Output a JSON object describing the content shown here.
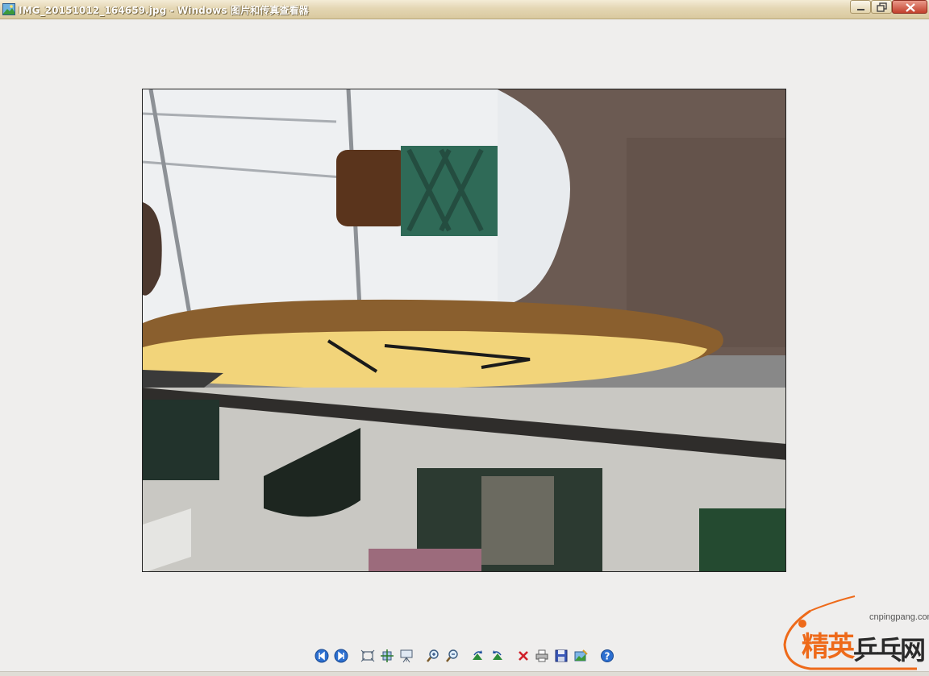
{
  "window": {
    "title": "IMG_20151012_164659.jpg - Windows 图片和传真查看器"
  },
  "toolbar": {
    "buttons": [
      {
        "name": "previous-image-button",
        "icon": "prev-circle-icon"
      },
      {
        "name": "next-image-button",
        "icon": "next-circle-icon"
      },
      {
        "name": "best-fit-button",
        "icon": "best-fit-icon"
      },
      {
        "name": "actual-size-button",
        "icon": "actual-size-icon"
      },
      {
        "name": "slideshow-button",
        "icon": "slideshow-icon"
      },
      {
        "name": "zoom-in-button",
        "icon": "zoom-in-icon"
      },
      {
        "name": "zoom-out-button",
        "icon": "zoom-out-icon"
      },
      {
        "name": "rotate-clockwise-button",
        "icon": "rotate-cw-icon"
      },
      {
        "name": "rotate-counterclockwise-button",
        "icon": "rotate-ccw-icon"
      },
      {
        "name": "delete-button",
        "icon": "delete-x-icon"
      },
      {
        "name": "print-button",
        "icon": "printer-icon"
      },
      {
        "name": "save-button",
        "icon": "floppy-disk-icon"
      },
      {
        "name": "open-for-editing-button",
        "icon": "edit-picture-icon"
      },
      {
        "name": "help-button",
        "icon": "help-icon"
      }
    ]
  },
  "watermark": {
    "url": "cnpingpang.com",
    "text_left": "精英",
    "text_right": "乒乓网",
    "accent_color": "#ee6a1a"
  },
  "colors": {
    "titlebar": "#e4d6b3",
    "background": "#efeeed",
    "close_button": "#c2402c"
  }
}
